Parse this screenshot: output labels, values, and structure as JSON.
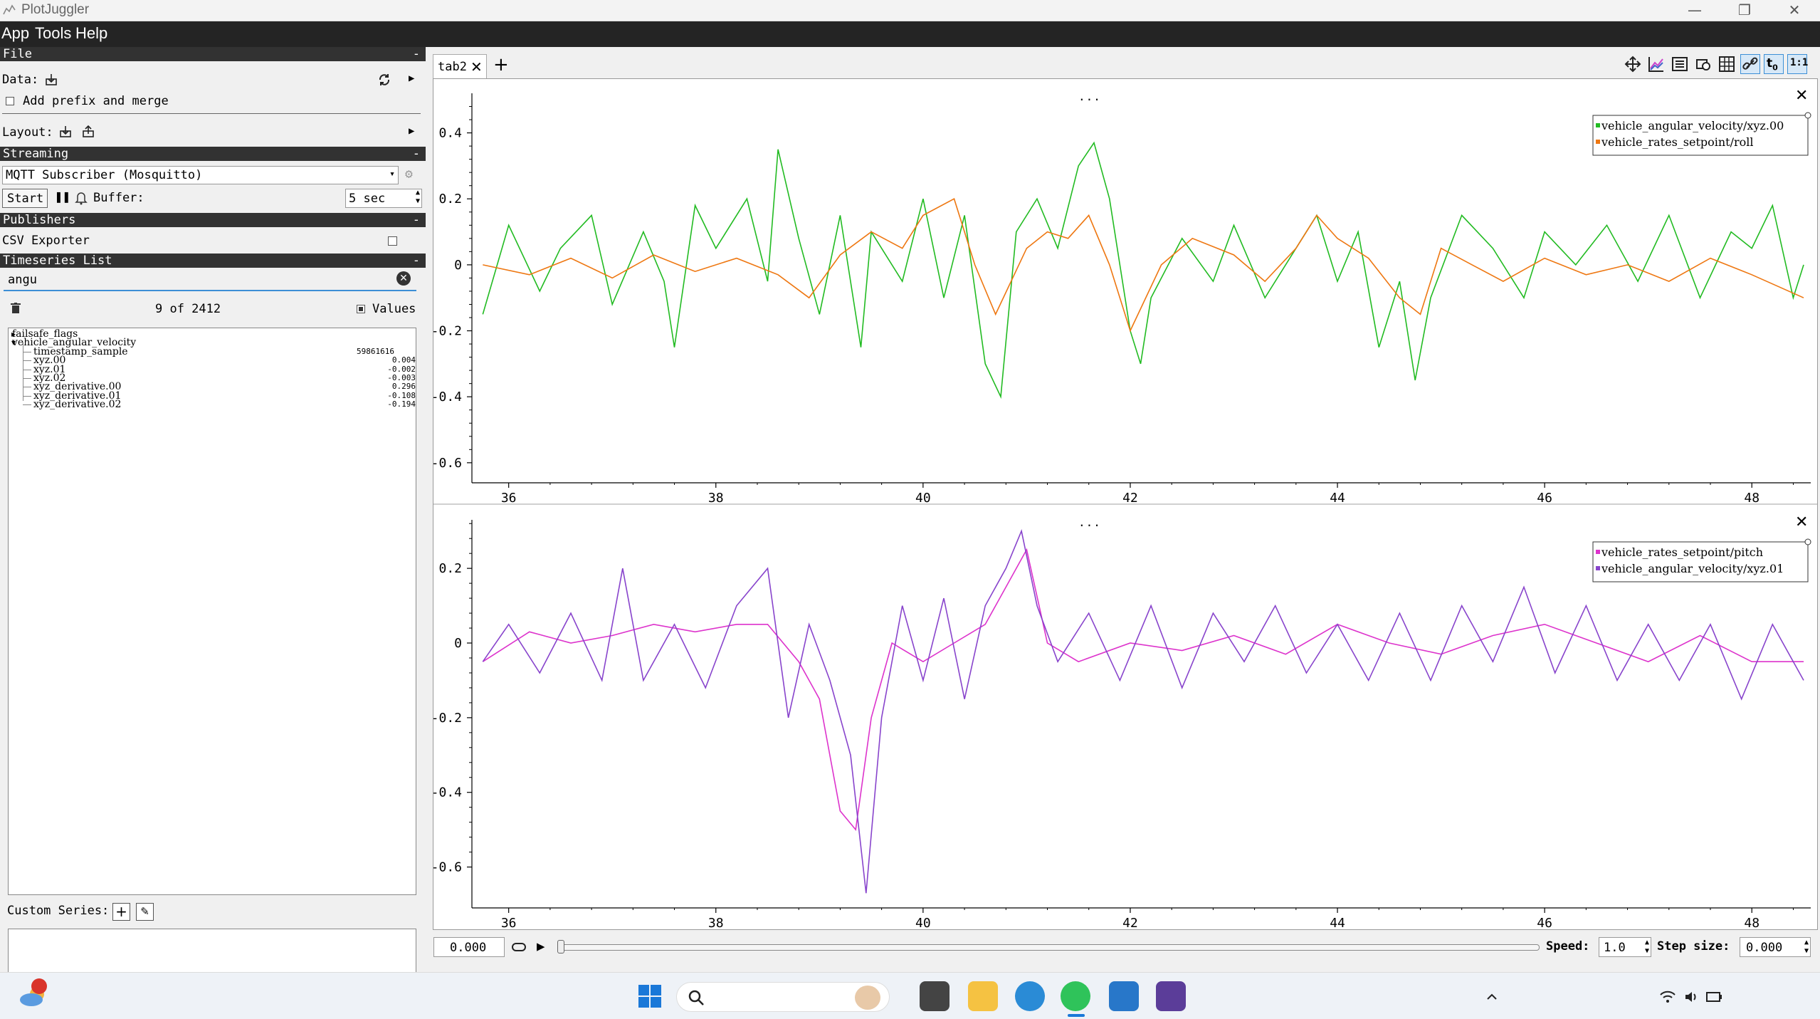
{
  "window": {
    "title": "PlotJuggler"
  },
  "menu": [
    "App",
    "Tools",
    "Help"
  ],
  "file_section": {
    "title": "File",
    "data_label": "Data:",
    "prefix_label": "Add prefix and merge",
    "layout_label": "Layout:"
  },
  "streaming": {
    "title": "Streaming",
    "plugin": "MQTT Subscriber (Mosquitto)",
    "start_label": "Start",
    "buffer_label": "Buffer:",
    "buffer_value": "5 sec"
  },
  "publishers": {
    "title": "Publishers",
    "csv_label": "CSV Exporter"
  },
  "timeseries": {
    "title": "Timeseries List",
    "filter": "angu",
    "count": "9 of 2412",
    "values_label": "Values",
    "tree": [
      {
        "name": "failsafe_flags",
        "value": "",
        "level": 0,
        "expanded": false
      },
      {
        "name": "vehicle_angular_velocity",
        "value": "",
        "level": 0,
        "expanded": true
      },
      {
        "name": "timestamp_sample",
        "value": "59861616",
        "level": 1
      },
      {
        "name": "xyz.00",
        "value": "0.004",
        "level": 1
      },
      {
        "name": "xyz.01",
        "value": "-0.002",
        "level": 1
      },
      {
        "name": "xyz.02",
        "value": "-0.003",
        "level": 1
      },
      {
        "name": "xyz_derivative.00",
        "value": "0.296",
        "level": 1
      },
      {
        "name": "xyz_derivative.01",
        "value": "-0.108",
        "level": 1
      },
      {
        "name": "xyz_derivative.02",
        "value": "-0.194",
        "level": 1
      }
    ]
  },
  "custom_series": {
    "label": "Custom Series:"
  },
  "tabs": [
    {
      "label": "tab2",
      "close": "✕"
    }
  ],
  "add_tab": "+",
  "plot_menu": "...",
  "playback": {
    "time_value": "0.000",
    "speed_label": "Speed:",
    "speed_value": "1.0",
    "step_label": "Step size:",
    "step_value": "0.000"
  },
  "chart_data": [
    {
      "type": "line",
      "xlim": [
        35.7,
        48.5
      ],
      "ylim": [
        -0.65,
        0.52
      ],
      "xticks": [
        "36",
        "38",
        "40",
        "42",
        "44",
        "46",
        "48"
      ],
      "yticks": [
        {
          "v": 0.4,
          "label": "0.4"
        },
        {
          "v": 0.2,
          "label": "0.2"
        },
        {
          "v": 0,
          "label": "0"
        },
        {
          "v": -0.2,
          "label": "-0.2"
        },
        {
          "v": -0.4,
          "label": "-0.4"
        },
        {
          "v": -0.6,
          "label": "-0.6"
        }
      ],
      "legend_position": "top-right",
      "series": [
        {
          "name": "vehicle_angular_velocity/xyz.00",
          "color": "#22bb22",
          "x": [
            35.75,
            36.0,
            36.3,
            36.5,
            36.8,
            37.0,
            37.3,
            37.5,
            37.6,
            37.8,
            38.0,
            38.3,
            38.5,
            38.6,
            38.8,
            39.0,
            39.2,
            39.4,
            39.5,
            39.8,
            40.0,
            40.2,
            40.4,
            40.6,
            40.75,
            40.9,
            41.1,
            41.3,
            41.5,
            41.65,
            41.8,
            42.0,
            42.1,
            42.2,
            42.5,
            42.8,
            43.0,
            43.3,
            43.6,
            43.8,
            44.0,
            44.2,
            44.4,
            44.6,
            44.75,
            44.9,
            45.2,
            45.5,
            45.8,
            46.0,
            46.3,
            46.6,
            46.9,
            47.2,
            47.5,
            47.8,
            48.0,
            48.2,
            48.4,
            48.5
          ],
          "values": [
            -0.15,
            0.12,
            -0.08,
            0.05,
            0.15,
            -0.12,
            0.1,
            -0.05,
            -0.25,
            0.18,
            0.05,
            0.2,
            -0.05,
            0.35,
            0.08,
            -0.15,
            0.15,
            -0.25,
            0.1,
            -0.05,
            0.2,
            -0.1,
            0.15,
            -0.3,
            -0.4,
            0.1,
            0.2,
            0.05,
            0.3,
            0.37,
            0.2,
            -0.2,
            -0.3,
            -0.1,
            0.08,
            -0.05,
            0.12,
            -0.1,
            0.05,
            0.15,
            -0.05,
            0.1,
            -0.25,
            -0.05,
            -0.35,
            -0.1,
            0.15,
            0.05,
            -0.1,
            0.1,
            0.0,
            0.12,
            -0.05,
            0.15,
            -0.1,
            0.1,
            0.05,
            0.18,
            -0.1,
            0.0
          ]
        },
        {
          "name": "vehicle_rates_setpoint/roll",
          "color": "#ee7711",
          "x": [
            35.75,
            36.2,
            36.6,
            37.0,
            37.4,
            37.8,
            38.2,
            38.6,
            38.9,
            39.2,
            39.5,
            39.8,
            40.0,
            40.3,
            40.5,
            40.7,
            41.0,
            41.2,
            41.4,
            41.6,
            41.8,
            42.0,
            42.3,
            42.6,
            43.0,
            43.3,
            43.6,
            43.8,
            44.0,
            44.3,
            44.6,
            44.8,
            45.0,
            45.3,
            45.6,
            46.0,
            46.4,
            46.8,
            47.2,
            47.6,
            48.0,
            48.5
          ],
          "values": [
            0.0,
            -0.03,
            0.02,
            -0.04,
            0.03,
            -0.02,
            0.02,
            -0.03,
            -0.1,
            0.03,
            0.1,
            0.05,
            0.15,
            0.2,
            0.0,
            -0.15,
            0.05,
            0.1,
            0.08,
            0.15,
            0.0,
            -0.2,
            0.0,
            0.08,
            0.03,
            -0.05,
            0.05,
            0.15,
            0.08,
            0.02,
            -0.1,
            -0.15,
            0.05,
            0.0,
            -0.05,
            0.02,
            -0.03,
            0.0,
            -0.05,
            0.02,
            -0.03,
            -0.1
          ]
        }
      ]
    },
    {
      "type": "line",
      "xlim": [
        35.7,
        48.5
      ],
      "ylim": [
        -0.7,
        0.33
      ],
      "xticks": [
        "36",
        "38",
        "40",
        "42",
        "44",
        "46",
        "48"
      ],
      "yticks": [
        {
          "v": 0.2,
          "label": "0.2"
        },
        {
          "v": 0,
          "label": "0"
        },
        {
          "v": -0.2,
          "label": "-0.2"
        },
        {
          "v": -0.4,
          "label": "-0.4"
        },
        {
          "v": -0.6,
          "label": "-0.6"
        }
      ],
      "legend_position": "top-right",
      "series": [
        {
          "name": "vehicle_rates_setpoint/pitch",
          "color": "#dd33cc",
          "x": [
            35.75,
            36.2,
            36.6,
            37.0,
            37.4,
            37.8,
            38.2,
            38.5,
            38.8,
            39.0,
            39.2,
            39.35,
            39.5,
            39.7,
            40.0,
            40.3,
            40.6,
            40.8,
            41.0,
            41.2,
            41.5,
            42.0,
            42.5,
            43.0,
            43.5,
            44.0,
            44.5,
            45.0,
            45.5,
            46.0,
            46.5,
            47.0,
            47.5,
            48.0,
            48.5
          ],
          "values": [
            -0.05,
            0.03,
            0.0,
            0.02,
            0.05,
            0.03,
            0.05,
            0.05,
            -0.05,
            -0.15,
            -0.45,
            -0.5,
            -0.2,
            0.0,
            -0.05,
            0.0,
            0.05,
            0.15,
            0.25,
            0.0,
            -0.05,
            0.0,
            -0.02,
            0.02,
            -0.03,
            0.05,
            0.0,
            -0.03,
            0.02,
            0.05,
            0.0,
            -0.05,
            0.02,
            -0.05,
            -0.05
          ]
        },
        {
          "name": "vehicle_angular_velocity/xyz.01",
          "color": "#8844cc",
          "x": [
            35.75,
            36.0,
            36.3,
            36.6,
            36.9,
            37.1,
            37.3,
            37.6,
            37.9,
            38.2,
            38.5,
            38.7,
            38.9,
            39.1,
            39.3,
            39.45,
            39.6,
            39.8,
            40.0,
            40.2,
            40.4,
            40.6,
            40.8,
            40.95,
            41.1,
            41.3,
            41.6,
            41.9,
            42.2,
            42.5,
            42.8,
            43.1,
            43.4,
            43.7,
            44.0,
            44.3,
            44.6,
            44.9,
            45.2,
            45.5,
            45.8,
            46.1,
            46.4,
            46.7,
            47.0,
            47.3,
            47.6,
            47.9,
            48.2,
            48.5
          ],
          "values": [
            -0.05,
            0.05,
            -0.08,
            0.08,
            -0.1,
            0.2,
            -0.1,
            0.05,
            -0.12,
            0.1,
            0.2,
            -0.2,
            0.05,
            -0.1,
            -0.3,
            -0.67,
            -0.2,
            0.1,
            -0.1,
            0.12,
            -0.15,
            0.1,
            0.2,
            0.3,
            0.1,
            -0.05,
            0.08,
            -0.1,
            0.1,
            -0.12,
            0.08,
            -0.05,
            0.1,
            -0.08,
            0.05,
            -0.1,
            0.08,
            -0.1,
            0.1,
            -0.05,
            0.15,
            -0.08,
            0.1,
            -0.1,
            0.05,
            -0.1,
            0.05,
            -0.15,
            0.05,
            -0.1
          ]
        }
      ]
    }
  ]
}
